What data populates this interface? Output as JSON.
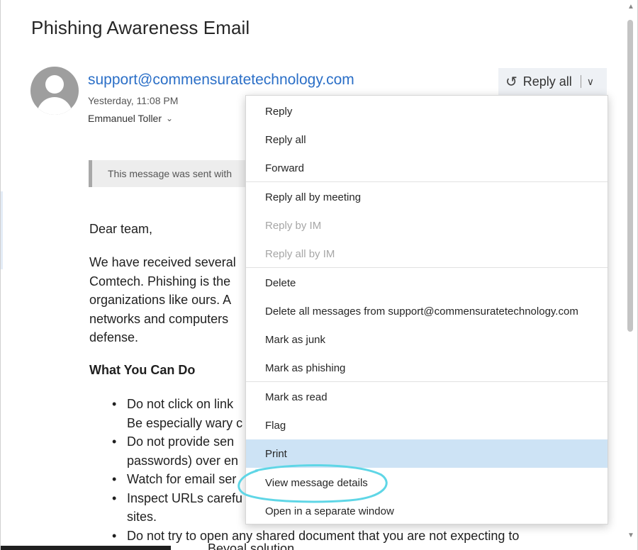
{
  "email": {
    "subject": "Phishing Awareness Email",
    "sender": "support@commensuratetechnology.com",
    "time": "Yesterday, 11:08 PM",
    "to": "Emmanuel Toller",
    "to_expand_icon": "double-chevron-down-icon",
    "banner": "This message was sent with",
    "greeting": "Dear team,",
    "paragraph_lines": [
      "We have received several",
      "Comtech. Phishing is the",
      "organizations like ours. A",
      "networks and computers",
      "defense."
    ],
    "section_heading": "What You Can Do",
    "bullets": [
      {
        "lines": [
          "Do not click on link",
          "Be especially wary c"
        ]
      },
      {
        "lines": [
          "Do not provide sen",
          "passwords) over en"
        ]
      },
      {
        "lines": [
          "Watch for email ser"
        ]
      },
      {
        "lines": [
          "Inspect URLs carefu",
          "sites."
        ]
      },
      {
        "lines": [
          "Do not try to open any shared document that you are not expecting to"
        ]
      }
    ],
    "bottom_partial": "Beyoal solution"
  },
  "reply_button": {
    "label": "Reply all",
    "icon": "reply-all-icon",
    "dropdown_icon": "chevron-down-icon"
  },
  "menu": {
    "items": [
      {
        "label": "Reply",
        "disabled": false
      },
      {
        "label": "Reply all",
        "disabled": false
      },
      {
        "label": "Forward",
        "disabled": false
      },
      {
        "label": "Reply all by meeting",
        "disabled": false
      },
      {
        "label": "Reply by IM",
        "disabled": true
      },
      {
        "label": "Reply all by IM",
        "disabled": true
      },
      {
        "label": "Delete",
        "disabled": false
      },
      {
        "label": "Delete all messages from support@commensuratetechnology.com",
        "disabled": false
      },
      {
        "label": "Mark as junk",
        "disabled": false
      },
      {
        "label": "Mark as phishing",
        "disabled": false
      },
      {
        "label": "Mark as read",
        "disabled": false
      },
      {
        "label": "Flag",
        "disabled": false
      },
      {
        "label": "Print",
        "disabled": false,
        "highlighted": true
      },
      {
        "label": "View message details",
        "disabled": false
      },
      {
        "label": "Open in a separate window",
        "disabled": false
      }
    ]
  },
  "colors": {
    "sender_link": "#2b6fc7",
    "menu_highlight": "#cde3f5",
    "annotation": "#5fd6e6"
  }
}
